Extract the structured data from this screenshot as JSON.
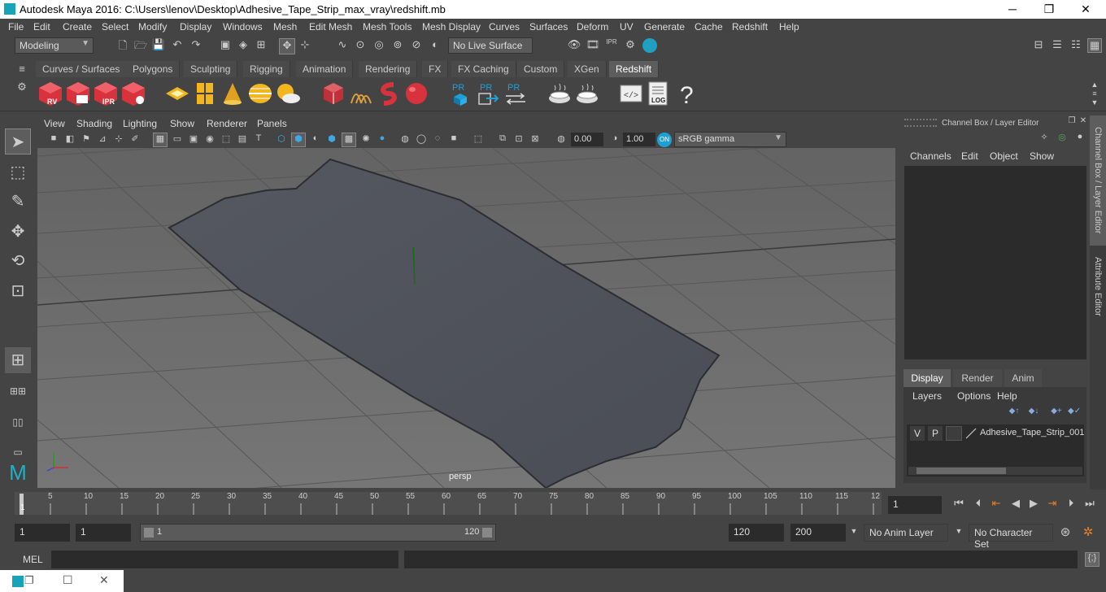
{
  "window": {
    "title": "Autodesk Maya 2016: C:\\Users\\lenov\\Desktop\\Adhesive_Tape_Strip_max_vray\\redshift.mb",
    "minimize": "─",
    "maximize": "❐",
    "close": "✕"
  },
  "menubar": [
    "File",
    "Edit",
    "Create",
    "Select",
    "Modify",
    "Display",
    "Windows",
    "Mesh",
    "Edit Mesh",
    "Mesh Tools",
    "Mesh Display",
    "Curves",
    "Surfaces",
    "Deform",
    "UV",
    "Generate",
    "Cache",
    "Redshift",
    "Help"
  ],
  "statusline": {
    "mode": "Modeling",
    "live_surface": "No Live Surface"
  },
  "shelf_tabs": [
    "Curves / Surfaces",
    "Polygons",
    "Sculpting",
    "Rigging",
    "Animation",
    "Rendering",
    "FX",
    "FX Caching",
    "Custom",
    "XGen",
    "Redshift"
  ],
  "shelf_active": "Redshift",
  "shelf_labels": {
    "rv": "RV",
    "ipr": "IPR",
    "pr": "PR",
    "log": "LOG",
    "help": "?"
  },
  "viewport": {
    "menu": [
      "View",
      "Shading",
      "Lighting",
      "Show",
      "Renderer",
      "Panels"
    ],
    "exposure": "0.00",
    "gamma": "1.00",
    "color_space": "sRGB gamma",
    "camera_label": "persp"
  },
  "channel_box": {
    "title": "Channel Box / Layer Editor",
    "menu": [
      "Channels",
      "Edit",
      "Object",
      "Show"
    ]
  },
  "layer_editor": {
    "tabs": [
      "Display",
      "Render",
      "Anim"
    ],
    "active_tab": "Display",
    "menu": [
      "Layers",
      "Options",
      "Help"
    ],
    "layers": [
      {
        "v": "V",
        "p": "P",
        "name": "Adhesive_Tape_Strip_001"
      }
    ]
  },
  "side_tabs": [
    "Channel Box / Layer Editor",
    "Attribute Editor"
  ],
  "timeline": {
    "ticks": [
      "1",
      "5",
      "10",
      "15",
      "20",
      "25",
      "30",
      "35",
      "40",
      "45",
      "50",
      "55",
      "60",
      "65",
      "70",
      "75",
      "80",
      "85",
      "90",
      "95",
      "100",
      "105",
      "110",
      "115",
      "12"
    ],
    "current_frame": "1"
  },
  "range": {
    "start": "1",
    "playback_start": "1",
    "slider_start": "1",
    "slider_end": "120",
    "playback_end": "120",
    "end": "200",
    "anim_layer": "No Anim Layer",
    "character_set": "No Character Set"
  },
  "cmdline": {
    "label": "MEL"
  },
  "colors": {
    "accent_blue": "#1e9fd6",
    "redshift_red": "#d8323c",
    "icon_yellow": "#f2b620"
  }
}
